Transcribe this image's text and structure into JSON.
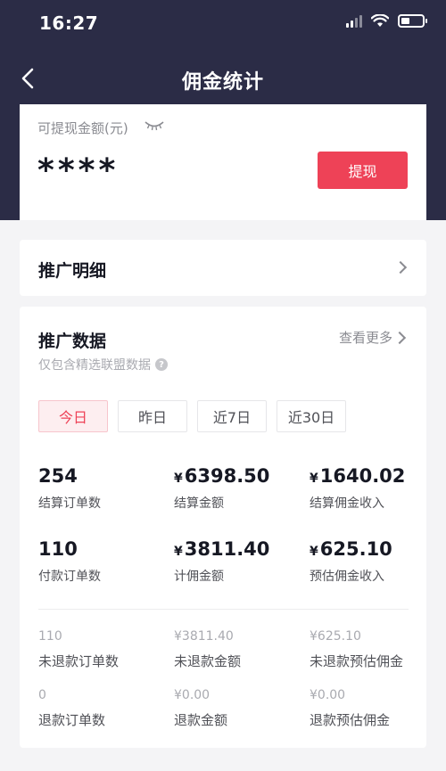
{
  "status_bar": {
    "time": "16:27"
  },
  "nav": {
    "title": "佣金统计"
  },
  "balance": {
    "label": "可提现金额(元)",
    "value": "****",
    "withdraw_label": "提现"
  },
  "promo_detail": {
    "label": "推广明细"
  },
  "promo_data": {
    "title": "推广数据",
    "more_label": "查看更多",
    "subtitle": "仅包含精选联盟数据",
    "tabs": [
      {
        "label": "今日",
        "active": true
      },
      {
        "label": "昨日",
        "active": false
      },
      {
        "label": "近7日",
        "active": false
      },
      {
        "label": "近30日",
        "active": false
      }
    ],
    "stats": [
      {
        "value": "254",
        "label": "结算订单数"
      },
      {
        "value": "6398.50",
        "currency": "¥",
        "label": "结算金额"
      },
      {
        "value": "1640.02",
        "currency": "¥",
        "label": "结算佣金收入"
      },
      {
        "value": "110",
        "label": "付款订单数"
      },
      {
        "value": "3811.40",
        "currency": "¥",
        "label": "计佣金额"
      },
      {
        "value": "625.10",
        "currency": "¥",
        "label": "预估佣金收入"
      }
    ],
    "sub_stats": [
      {
        "value": "110",
        "label": "未退款订单数"
      },
      {
        "value": "¥3811.40",
        "label": "未退款金额"
      },
      {
        "value": "¥625.10",
        "label": "未退款预估佣金"
      },
      {
        "value": "0",
        "label": "退款订单数"
      },
      {
        "value": "¥0.00",
        "label": "退款金额"
      },
      {
        "value": "¥0.00",
        "label": "退款预估佣金"
      }
    ]
  },
  "colors": {
    "header_bg": "#2b2c46",
    "accent": "#ee4257",
    "page_bg": "#f4f4f6"
  },
  "icons": [
    "back-arrow-icon",
    "eye-closed-icon",
    "chevron-right-icon",
    "help-icon",
    "signal-icon",
    "wifi-icon",
    "battery-icon"
  ]
}
